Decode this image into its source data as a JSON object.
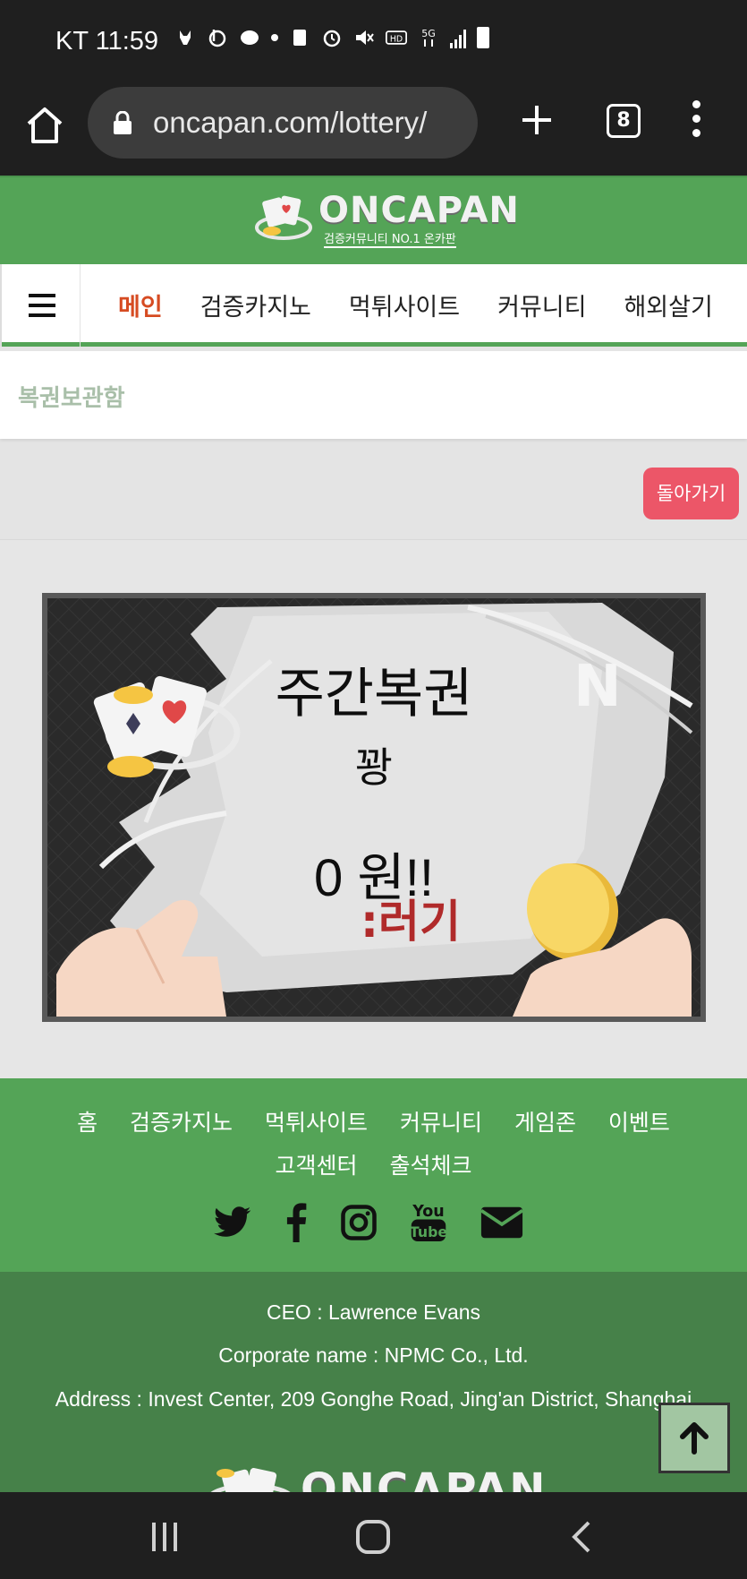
{
  "status_bar": {
    "time": "KT 11:59",
    "icons": [
      "fox-icon",
      "b-icon",
      "cloud-icon",
      "dot-icon",
      "recycle-icon",
      "alarm-icon",
      "mute-icon",
      "hd-icon",
      "5g-icon",
      "signal-icon",
      "battery-icon"
    ]
  },
  "browser": {
    "url": "oncapan.com/lottery/",
    "tab_count": "8"
  },
  "site": {
    "logo_text": "ONCAPAN",
    "logo_tagline": "검증커뮤니티 NO.1 온카판"
  },
  "nav": {
    "items": [
      "메인",
      "검증카지노",
      "먹튀사이트",
      "커뮤니티",
      "해외살기"
    ],
    "active_index": 0
  },
  "page": {
    "title": "복권보관함",
    "back_label": "돌아가기"
  },
  "scratch_card": {
    "title": "주간복권",
    "subtitle": "꽝",
    "amount": "0 원!!"
  },
  "footer": {
    "links_row1": [
      "홈",
      "검증카지노",
      "먹튀사이트",
      "커뮤니티",
      "게임존",
      "이벤트"
    ],
    "links_row2": [
      "고객센터",
      "출석체크"
    ],
    "social": [
      "twitter-icon",
      "facebook-icon",
      "instagram-icon",
      "youtube-icon",
      "email-icon"
    ],
    "ceo": "CEO : Lawrence Evans",
    "corporate": "Corporate name : NPMC Co., Ltd.",
    "address": "Address : Invest Center, 209 Gonghe Road, Jing'an District, Shanghai",
    "logo_text": "ONCAPAN"
  },
  "colors": {
    "brand_green": "#54a457",
    "footer_dark_green": "#468149",
    "active_nav": "#d64b22",
    "back_button": "#ec5668"
  }
}
